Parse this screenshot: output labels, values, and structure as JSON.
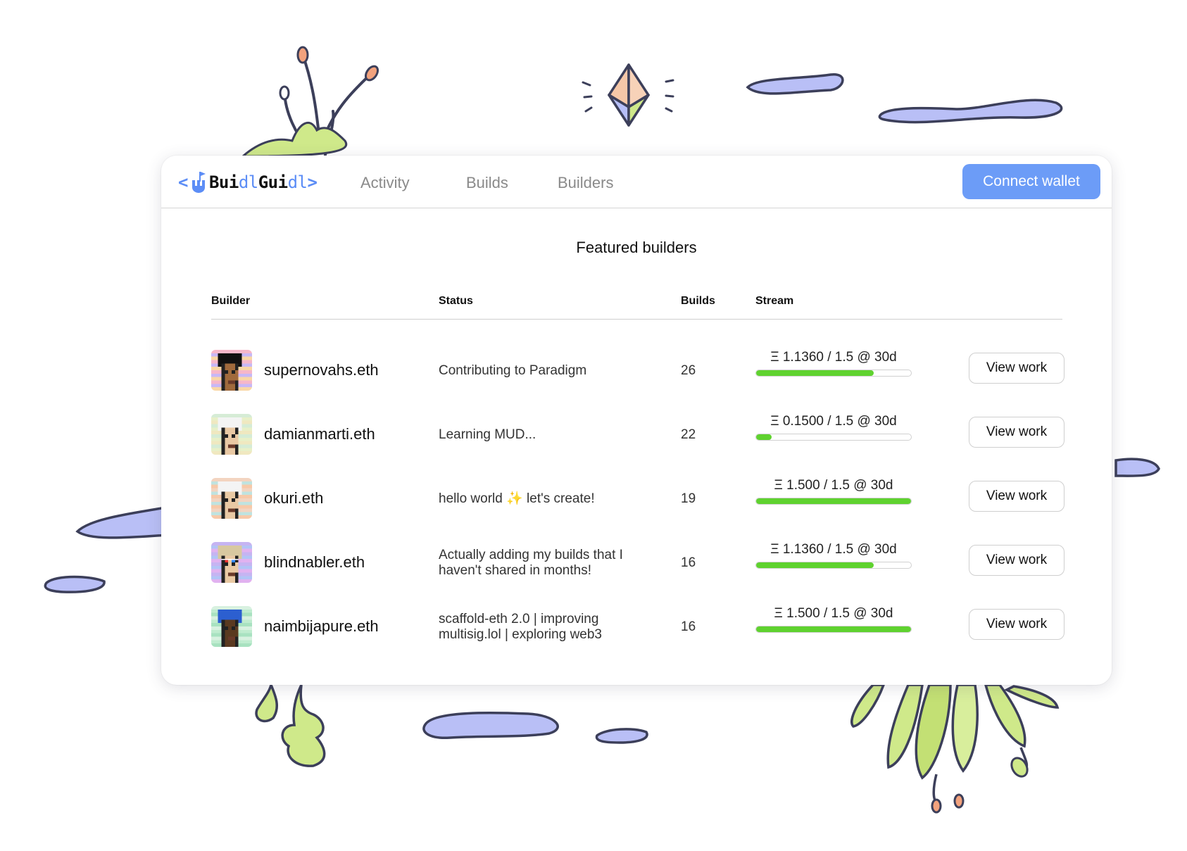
{
  "app": {
    "logo": {
      "open_bracket": "<",
      "part1": "Bui",
      "part2": "dl",
      "part3": "Gui",
      "part4": "dl",
      "close_bracket": ">"
    },
    "nav": [
      {
        "label": "Activity"
      },
      {
        "label": "Builds"
      },
      {
        "label": "Builders"
      }
    ],
    "connect_label": "Connect wallet",
    "accent_color": "#6c9cf7",
    "stream_color": "#5fd22f"
  },
  "featured": {
    "title": "Featured builders",
    "columns": {
      "builder": "Builder",
      "status": "Status",
      "builds": "Builds",
      "stream": "Stream"
    },
    "rows": [
      {
        "name": "supernovahs.eth",
        "status": "Contributing to Paradigm",
        "builds": "26",
        "stream": "Ξ 1.1360 / 1.5 @ 30d",
        "stream_fraction": 0.757,
        "action": "View work",
        "avatar_icon": "punk-dark-hair"
      },
      {
        "name": "damianmarti.eth",
        "status": "Learning MUD...",
        "builds": "22",
        "stream": "Ξ 0.1500 / 1.5 @ 30d",
        "stream_fraction": 0.1,
        "action": "View work",
        "avatar_icon": "punk-white-hair"
      },
      {
        "name": "okuri.eth",
        "status": "hello world ✨ let's create!",
        "builds": "19",
        "stream": "Ξ 1.500 / 1.5 @ 30d",
        "stream_fraction": 1.0,
        "action": "View work",
        "avatar_icon": "punk-white-hair"
      },
      {
        "name": "blindnabler.eth",
        "status": "Actually adding my builds that I haven't shared in months!",
        "builds": "16",
        "stream": "Ξ 1.1360 / 1.5 @ 30d",
        "stream_fraction": 0.757,
        "action": "View work",
        "avatar_icon": "punk-3d-glasses"
      },
      {
        "name": "naimbijapure.eth",
        "status": "scaffold-eth 2.0 | improving multisig.lol | exploring web3",
        "builds": "16",
        "stream": "Ξ 1.500 / 1.5 @ 30d",
        "stream_fraction": 1.0,
        "action": "View work",
        "avatar_icon": "punk-bandana"
      }
    ]
  }
}
